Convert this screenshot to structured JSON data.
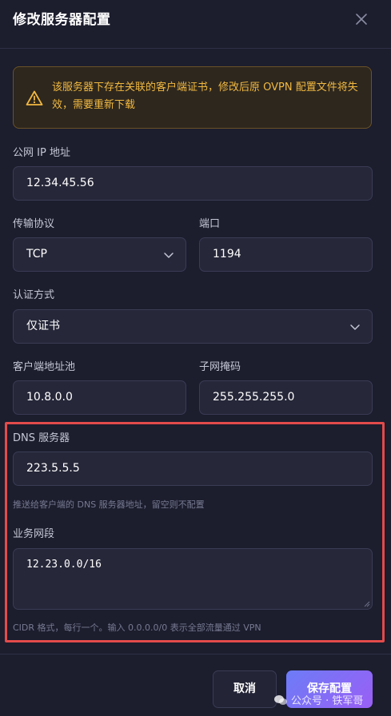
{
  "dialog": {
    "title": "修改服务器配置",
    "warning": "该服务器下存在关联的客户端证书，修改后原 OVPN 配置文件将失效，需要重新下载"
  },
  "fields": {
    "public_ip": {
      "label": "公网 IP 地址",
      "value": "12.34.45.56"
    },
    "protocol": {
      "label": "传输协议",
      "value": "TCP"
    },
    "port": {
      "label": "端口",
      "value": "1194"
    },
    "auth": {
      "label": "认证方式",
      "value": "仅证书"
    },
    "pool": {
      "label": "客户端地址池",
      "value": "10.8.0.0"
    },
    "mask": {
      "label": "子网掩码",
      "value": "255.255.255.0"
    },
    "dns": {
      "label": "DNS 服务器",
      "value": "223.5.5.5",
      "hint": "推送给客户端的 DNS 服务器地址，留空则不配置"
    },
    "segments": {
      "label": "业务网段",
      "value": "12.23.0.0/16",
      "hint": "CIDR 格式，每行一个。输入 0.0.0.0/0 表示全部流量通过 VPN"
    }
  },
  "buttons": {
    "cancel": "取消",
    "save": "保存配置"
  },
  "watermark": "公众号 · 铁军哥",
  "icons": [
    "close-icon",
    "warning-icon",
    "chevron-down-icon",
    "resize-handle-icon",
    "wechat-icon"
  ],
  "colors": {
    "background": "#1c1d2d",
    "field_bg": "#262739",
    "warning_text": "#f2b941",
    "highlight_border": "#e34b4b",
    "primary_gradient_start": "#6c7cf7",
    "primary_gradient_end": "#9a5ff5"
  }
}
